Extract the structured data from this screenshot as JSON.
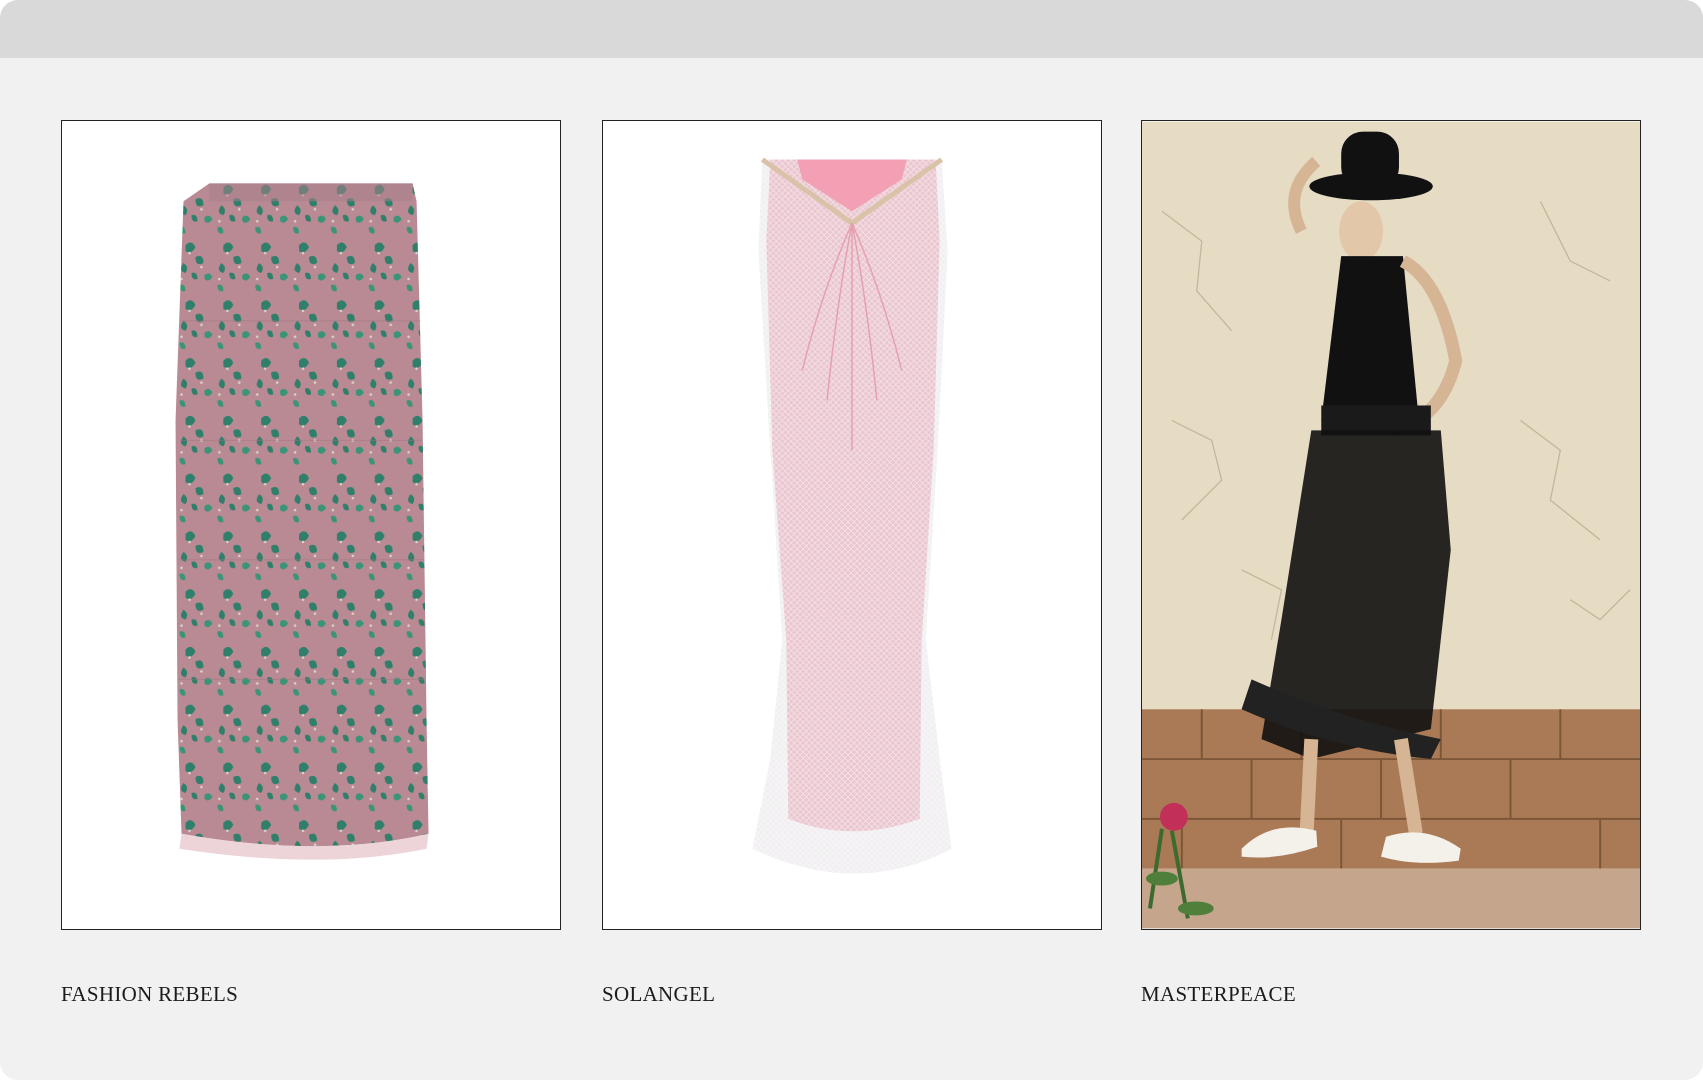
{
  "products": [
    {
      "brand": "FASHION REBELS",
      "image": {
        "icon": "pink-floral-lace-pencil-skirt-image",
        "background": "#ffffff",
        "garment_color": "#b98a93",
        "pattern_color": "#2f7f6b"
      }
    },
    {
      "brand": "SOLANGEL",
      "image": {
        "icon": "pink-crystal-mesh-maxi-skirt-image",
        "background": "#ffffff",
        "garment_color": "#f0a7b6",
        "mesh_color": "#e5e2e5"
      }
    },
    {
      "brand": "MASTERPEACE",
      "image": {
        "icon": "model-black-lace-ruffle-skirt-photo",
        "wall_color": "#e6dcc4",
        "stone_color": "#a97a55",
        "outfit_color": "#111111"
      }
    }
  ]
}
